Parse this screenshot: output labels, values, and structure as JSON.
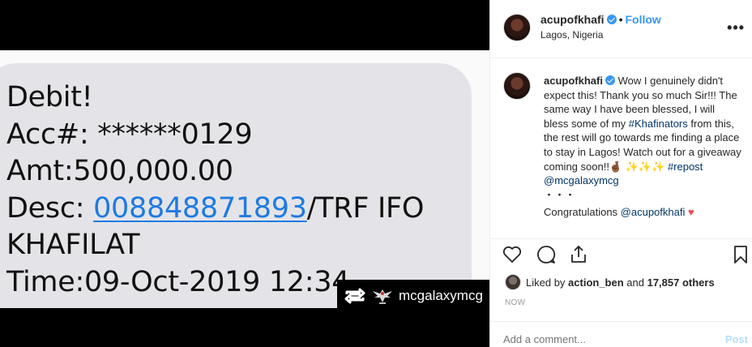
{
  "media": {
    "sms_lines": [
      "Debit!",
      "Acc#: ******0129",
      "Amt:500,000.00"
    ],
    "desc_prefix": "Desc: ",
    "desc_link": "008848871893",
    "desc_suffix": "/TRF IFO",
    "line_khafilat": "KHAFILAT",
    "line_time": "Time:09-Oct-2019 12:34",
    "watermark_name": "mcgalaxymcg"
  },
  "header": {
    "username": "acupofkhafi",
    "follow_label": "Follow",
    "location": "Lagos, Nigeria",
    "more_icon": "more-horizontal-icon"
  },
  "caption": {
    "username": "acupofkhafi",
    "text_before_tag": "Wow I genuinely didn't expect this! Thank you so much Sir!!! The same way I have been blessed, I will bless some of my ",
    "hashtag_khafinators": "#Khafinators",
    "text_after_tag": " from this, the rest will go towards me finding a place to stay in Lagos! Watch out for a giveaway coming soon!!🤞🏾",
    "sparkles": "✨✨✨",
    "hashtag_repost": "#repost",
    "mention_mcgalaxy": "@mcgalaxymcg",
    "dots": "・・・",
    "congrats_text": "Congratulations ",
    "mention_acupofkhafi": "@acupofkhafi",
    "heart": "♥"
  },
  "likes": {
    "prefix": "Liked by ",
    "user": "action_ben",
    "middle": " and ",
    "count": "17,857 others"
  },
  "timestamp": "NOW",
  "comment": {
    "placeholder": "Add a comment...",
    "post_label": "Post"
  },
  "colors": {
    "link_blue": "#3897f0",
    "hashtag_blue": "#003569",
    "sms_link_blue": "#1e7be0",
    "heart_red": "#ed4956"
  }
}
